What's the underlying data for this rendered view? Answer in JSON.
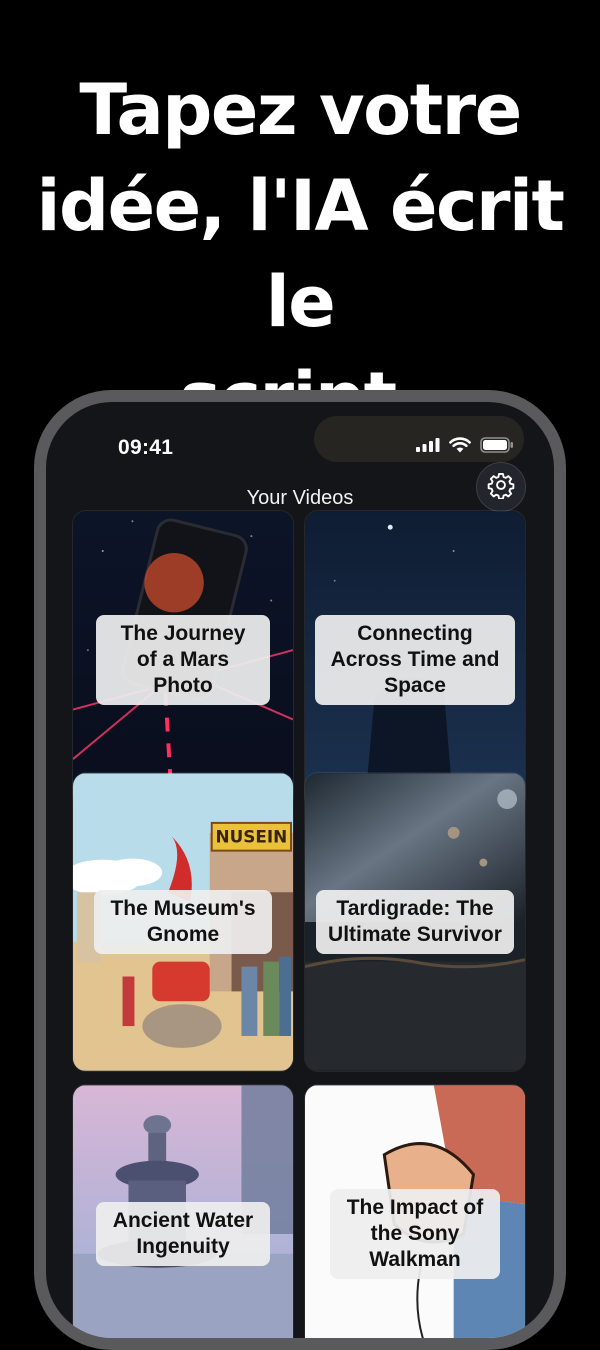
{
  "headline": {
    "line1": "Tapez votre",
    "line2": "idée, l'IA écrit le",
    "line3": "script."
  },
  "status_bar": {
    "time": "09:41"
  },
  "nav": {
    "title": "Your Videos"
  },
  "videos": [
    {
      "title": "The Journey of a Mars Photo"
    },
    {
      "title": "Connecting Across Time and Space"
    },
    {
      "title": "The Museum's Gnome"
    },
    {
      "title": "Tardigrade: The Ultimate Survivor"
    },
    {
      "title": "Ancient Water Ingenuity"
    },
    {
      "title": "The Impact of the Sony Walkman"
    }
  ],
  "artwork_text": {
    "museum_sign": "NUSEIN"
  }
}
